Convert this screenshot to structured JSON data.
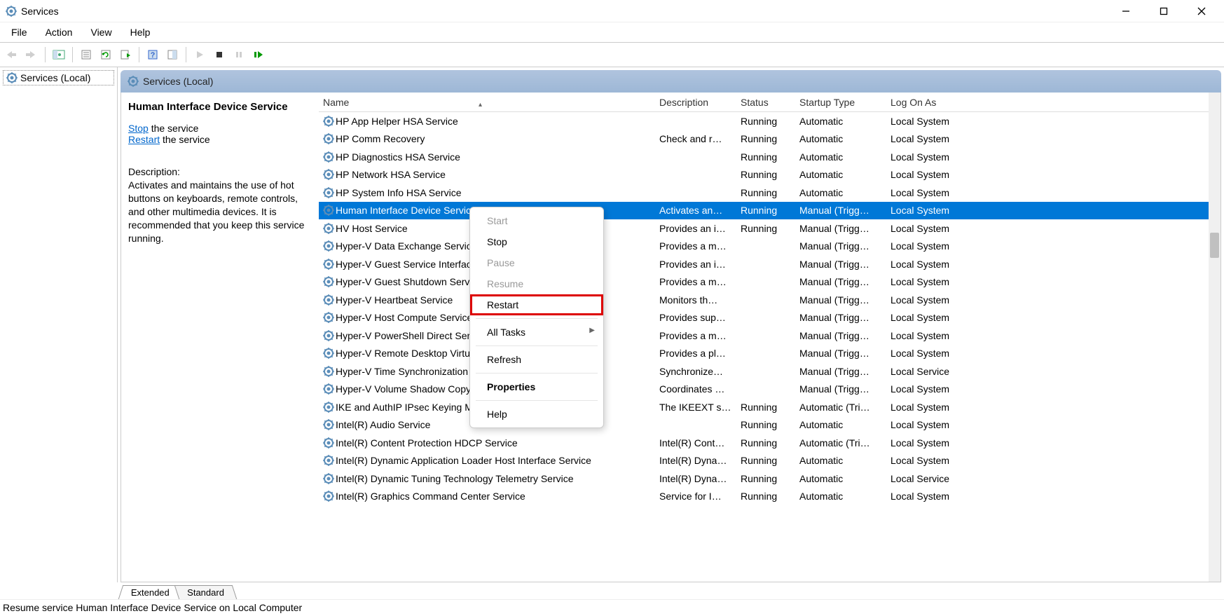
{
  "window": {
    "title": "Services"
  },
  "menu": {
    "items": [
      "File",
      "Action",
      "View",
      "Help"
    ]
  },
  "tree": {
    "root": "Services (Local)"
  },
  "detail": {
    "header": "Services (Local)",
    "selected_service": "Human Interface Device Service",
    "action_stop_label": "Stop",
    "action_stop_suffix": " the service",
    "action_restart_label": "Restart",
    "action_restart_suffix": " the service",
    "description_label": "Description:",
    "description_text": "Activates and maintains the use of hot buttons on keyboards, remote controls, and other multimedia devices. It is recommended that you keep this service running."
  },
  "columns": {
    "name": "Name",
    "description": "Description",
    "status": "Status",
    "startup": "Startup Type",
    "logon": "Log On As"
  },
  "services": [
    {
      "name": "HP App Helper HSA Service",
      "desc": "",
      "status": "Running",
      "startup": "Automatic",
      "logon": "Local System"
    },
    {
      "name": "HP Comm Recovery",
      "desc": "Check and r…",
      "status": "Running",
      "startup": "Automatic",
      "logon": "Local System"
    },
    {
      "name": "HP Diagnostics HSA Service",
      "desc": "",
      "status": "Running",
      "startup": "Automatic",
      "logon": "Local System"
    },
    {
      "name": "HP Network HSA Service",
      "desc": "",
      "status": "Running",
      "startup": "Automatic",
      "logon": "Local System"
    },
    {
      "name": "HP System Info HSA Service",
      "desc": "",
      "status": "Running",
      "startup": "Automatic",
      "logon": "Local System"
    },
    {
      "name": "Human Interface Device Service",
      "desc": "Activates an…",
      "status": "Running",
      "startup": "Manual (Trigg…",
      "logon": "Local System",
      "selected": true
    },
    {
      "name": "HV Host Service",
      "desc": "Provides an i…",
      "status": "Running",
      "startup": "Manual (Trigg…",
      "logon": "Local System"
    },
    {
      "name": "Hyper-V Data Exchange Service",
      "desc": "Provides a m…",
      "status": "",
      "startup": "Manual (Trigg…",
      "logon": "Local System"
    },
    {
      "name": "Hyper-V Guest Service Interface",
      "desc": "Provides an i…",
      "status": "",
      "startup": "Manual (Trigg…",
      "logon": "Local System"
    },
    {
      "name": "Hyper-V Guest Shutdown Service",
      "desc": "Provides a m…",
      "status": "",
      "startup": "Manual (Trigg…",
      "logon": "Local System"
    },
    {
      "name": "Hyper-V Heartbeat Service",
      "desc": "Monitors th…",
      "status": "",
      "startup": "Manual (Trigg…",
      "logon": "Local System"
    },
    {
      "name": "Hyper-V Host Compute Service",
      "desc": "Provides sup…",
      "status": "",
      "startup": "Manual (Trigg…",
      "logon": "Local System"
    },
    {
      "name": "Hyper-V PowerShell Direct Service",
      "desc": "Provides a m…",
      "status": "",
      "startup": "Manual (Trigg…",
      "logon": "Local System"
    },
    {
      "name": "Hyper-V Remote Desktop Virtualization Service",
      "desc": "Provides a pl…",
      "status": "",
      "startup": "Manual (Trigg…",
      "logon": "Local System"
    },
    {
      "name": "Hyper-V Time Synchronization Service",
      "desc": "Synchronize…",
      "status": "",
      "startup": "Manual (Trigg…",
      "logon": "Local Service"
    },
    {
      "name": "Hyper-V Volume Shadow Copy Requestor",
      "desc": "Coordinates …",
      "status": "",
      "startup": "Manual (Trigg…",
      "logon": "Local System"
    },
    {
      "name": "IKE and AuthIP IPsec Keying Modules",
      "desc": "The IKEEXT s…",
      "status": "Running",
      "startup": "Automatic (Tri…",
      "logon": "Local System"
    },
    {
      "name": "Intel(R) Audio Service",
      "desc": "",
      "status": "Running",
      "startup": "Automatic",
      "logon": "Local System"
    },
    {
      "name": "Intel(R) Content Protection HDCP Service",
      "desc": "Intel(R) Cont…",
      "status": "Running",
      "startup": "Automatic (Tri…",
      "logon": "Local System"
    },
    {
      "name": "Intel(R) Dynamic Application Loader Host Interface Service",
      "desc": "Intel(R) Dyna…",
      "status": "Running",
      "startup": "Automatic",
      "logon": "Local System"
    },
    {
      "name": "Intel(R) Dynamic Tuning Technology Telemetry Service",
      "desc": "Intel(R) Dyna…",
      "status": "Running",
      "startup": "Automatic",
      "logon": "Local Service"
    },
    {
      "name": "Intel(R) Graphics Command Center Service",
      "desc": "Service for I…",
      "status": "Running",
      "startup": "Automatic",
      "logon": "Local System"
    }
  ],
  "context_menu": {
    "items": [
      {
        "label": "Start",
        "disabled": true
      },
      {
        "label": "Stop"
      },
      {
        "label": "Pause",
        "disabled": true
      },
      {
        "label": "Resume",
        "disabled": true
      },
      {
        "label": "Restart",
        "highlighted": true
      },
      {
        "sep": true
      },
      {
        "label": "All Tasks",
        "submenu": true
      },
      {
        "sep": true
      },
      {
        "label": "Refresh"
      },
      {
        "sep": true
      },
      {
        "label": "Properties",
        "bold": true
      },
      {
        "sep": true
      },
      {
        "label": "Help"
      }
    ]
  },
  "tabs": {
    "extended": "Extended",
    "standard": "Standard"
  },
  "statusbar": "Resume service Human Interface Device Service on Local Computer"
}
